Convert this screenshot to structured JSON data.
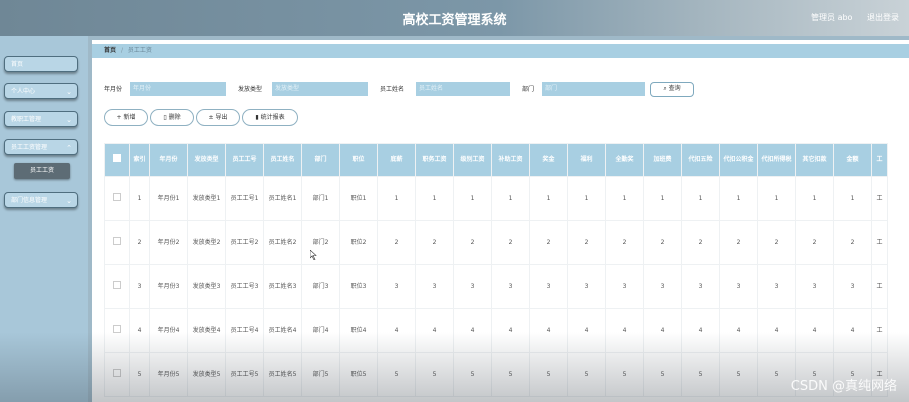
{
  "header": {
    "title": "高校工资管理系统",
    "user": "管理员 abo",
    "logout": "退出登录"
  },
  "sidebar": {
    "items": [
      {
        "label": "首页",
        "chevron": false
      },
      {
        "label": "个人中心",
        "chevron": true
      },
      {
        "label": "教职工管理",
        "chevron": true
      },
      {
        "label": "员工工资管理",
        "chevron": true
      },
      {
        "label": "部门信息管理",
        "chevron": true
      }
    ],
    "sub_item": "员工工资"
  },
  "breadcrumb": {
    "home": "首页",
    "sep": "/",
    "current": "员工工资"
  },
  "filters": [
    {
      "label": "年月份",
      "placeholder": "年月份"
    },
    {
      "label": "发放类型",
      "placeholder": "发放类型"
    },
    {
      "label": "员工姓名",
      "placeholder": "员工姓名"
    },
    {
      "label": "部门",
      "placeholder": "部门"
    }
  ],
  "query_button": "查询",
  "actions": {
    "add": "新增",
    "delete": "删除",
    "export": "导出",
    "stats": "统计报表"
  },
  "table": {
    "headers": [
      "索引",
      "年月份",
      "发放类型",
      "员工工号",
      "员工姓名",
      "部门",
      "职位",
      "底薪",
      "职务工资",
      "级别工资",
      "补助工资",
      "奖金",
      "福利",
      "全勤奖",
      "加班费",
      "代扣五险",
      "代扣公积金",
      "代扣所得税",
      "其它扣款",
      "金额",
      "工"
    ],
    "rows": [
      [
        "1",
        "年月份1",
        "发放类型1",
        "员工工号1",
        "员工姓名1",
        "部门1",
        "职位1",
        "1",
        "1",
        "1",
        "1",
        "1",
        "1",
        "1",
        "1",
        "1",
        "1",
        "1",
        "1",
        "1",
        "工"
      ],
      [
        "2",
        "年月份2",
        "发放类型2",
        "员工工号2",
        "员工姓名2",
        "部门2",
        "职位2",
        "2",
        "2",
        "2",
        "2",
        "2",
        "2",
        "2",
        "2",
        "2",
        "2",
        "2",
        "2",
        "2",
        "工"
      ],
      [
        "3",
        "年月份3",
        "发放类型3",
        "员工工号3",
        "员工姓名3",
        "部门3",
        "职位3",
        "3",
        "3",
        "3",
        "3",
        "3",
        "3",
        "3",
        "3",
        "3",
        "3",
        "3",
        "3",
        "3",
        "工"
      ],
      [
        "4",
        "年月份4",
        "发放类型4",
        "员工工号4",
        "员工姓名4",
        "部门4",
        "职位4",
        "4",
        "4",
        "4",
        "4",
        "4",
        "4",
        "4",
        "4",
        "4",
        "4",
        "4",
        "4",
        "4",
        "工"
      ],
      [
        "5",
        "年月份5",
        "发放类型5",
        "员工工号5",
        "员工姓名5",
        "部门5",
        "职位5",
        "5",
        "5",
        "5",
        "5",
        "5",
        "5",
        "5",
        "5",
        "5",
        "5",
        "5",
        "5",
        "5",
        "工"
      ]
    ]
  },
  "watermark": "CSDN @真纯网络",
  "icons": {
    "add": "plus-icon",
    "delete": "trash-icon",
    "export": "export-icon",
    "stats": "bar-chart-icon",
    "query": "search-icon",
    "chevron": "chevron-down-icon"
  }
}
